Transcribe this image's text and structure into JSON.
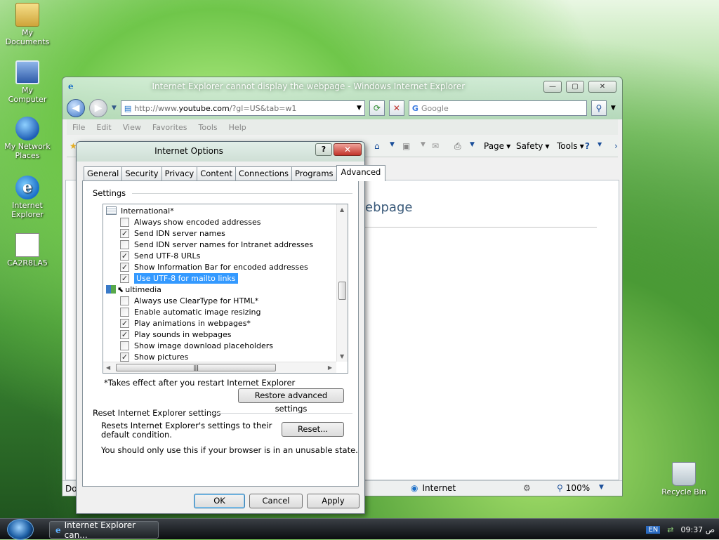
{
  "desktop": {
    "icons": [
      {
        "label": "My Documents"
      },
      {
        "label": "My Computer"
      },
      {
        "label": "My Network Places"
      },
      {
        "label": "Internet Explorer"
      },
      {
        "label": "CA2R8LA5"
      },
      {
        "label": "Recycle Bin"
      }
    ]
  },
  "ie": {
    "title": "Internet Explorer cannot display the webpage - Windows Internet Explorer",
    "address": {
      "prefix": "http://www.",
      "host": "youtube.com",
      "path": "/?gl=US&tab=w1"
    },
    "search_placeholder": "Google",
    "menu": [
      "File",
      "Edit",
      "View",
      "Favorites",
      "Tools",
      "Help"
    ],
    "commands": {
      "page": "Page",
      "safety": "Safety",
      "tools": "Tools"
    },
    "page_heading_fragment": "ebpage",
    "status": {
      "zone": "Internet",
      "zoom": "100%",
      "left_fragment": "Do"
    }
  },
  "dialog": {
    "title": "Internet Options",
    "help_label": "?",
    "tabs": [
      "General",
      "Security",
      "Privacy",
      "Content",
      "Connections",
      "Programs",
      "Advanced"
    ],
    "active_tab": "Advanced",
    "settings_label": "Settings",
    "tree": [
      {
        "type": "category",
        "label": "International*"
      },
      {
        "type": "checkbox",
        "label": "Always show encoded addresses",
        "checked": false
      },
      {
        "type": "checkbox",
        "label": "Send IDN server names",
        "checked": true
      },
      {
        "type": "checkbox",
        "label": "Send IDN server names for Intranet addresses",
        "checked": false
      },
      {
        "type": "checkbox",
        "label": "Send UTF-8 URLs",
        "checked": true
      },
      {
        "type": "checkbox",
        "label": "Show Information Bar for encoded addresses",
        "checked": true
      },
      {
        "type": "checkbox",
        "label": "Use UTF-8 for mailto links",
        "checked": true,
        "selected": true
      },
      {
        "type": "category",
        "label": "ultimedia"
      },
      {
        "type": "checkbox",
        "label": "Always use ClearType for HTML*",
        "checked": false
      },
      {
        "type": "checkbox",
        "label": "Enable automatic image resizing",
        "checked": false
      },
      {
        "type": "checkbox",
        "label": "Play animations in webpages*",
        "checked": true
      },
      {
        "type": "checkbox",
        "label": "Play sounds in webpages",
        "checked": true
      },
      {
        "type": "checkbox",
        "label": "Show image download placeholders",
        "checked": false
      },
      {
        "type": "checkbox",
        "label": "Show pictures",
        "checked": true
      }
    ],
    "restart_note": "*Takes effect after you restart Internet Explorer",
    "restore_button": "Restore advanced settings",
    "reset_group_label": "Reset Internet Explorer settings",
    "reset_description": "Resets Internet Explorer's settings to their default condition.",
    "reset_button": "Reset...",
    "reset_warning": "You should only use this if your browser is in an unusable state.",
    "ok": "OK",
    "cancel": "Cancel",
    "apply": "Apply"
  },
  "taskbar": {
    "task_label": "Internet Explorer can...",
    "language": "EN",
    "clock": "09:37 ص"
  }
}
